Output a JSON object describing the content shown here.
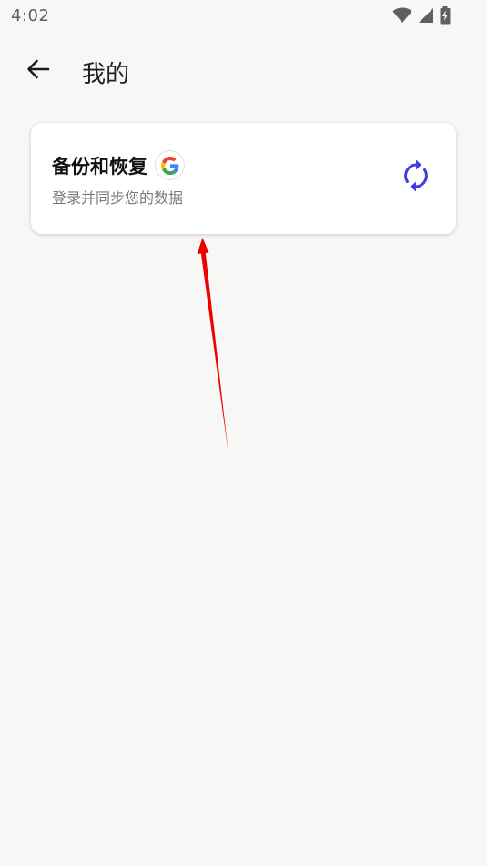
{
  "status_bar": {
    "time": "4:02",
    "icons": [
      "wifi-icon",
      "cellular-signal-icon",
      "battery-charging-icon"
    ]
  },
  "app_bar": {
    "back_icon": "arrow-left-icon",
    "title": "我的"
  },
  "backup_card": {
    "title": "备份和恢复",
    "subtitle": "登录并同步您的数据",
    "badge_icon": "google-logo-icon",
    "action_icon": "sync-icon"
  },
  "colors": {
    "background": "#f7f7f5",
    "card": "#ffffff",
    "sync_accent": "#3f3fe0",
    "annotation_arrow": "#ee0000"
  }
}
